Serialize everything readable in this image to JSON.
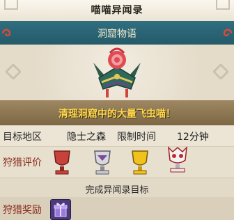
{
  "header": {
    "title": "喵喵异闻录"
  },
  "quest": {
    "name": "洞窟物语",
    "objective": "清理洞窟中的大量飞虫喵！",
    "area_label": "目标地区",
    "area_value": "隐士之森",
    "time_label": "限制时间",
    "time_value": "12分钟",
    "rating_label": "狩猎评价",
    "complete_label": "完成异闻录目标",
    "reward_label": "狩猎奖励"
  },
  "colors": {
    "teal": "#2f6f80",
    "banner": "#8a7350",
    "objective_text": "#ffd84d",
    "label_red": "#8a2a1c"
  },
  "icons": [
    "emblem-icon",
    "trophy-red-icon",
    "trophy-silver-icon",
    "trophy-gold-icon",
    "trophy-platinum-icon",
    "gift-box-icon"
  ]
}
